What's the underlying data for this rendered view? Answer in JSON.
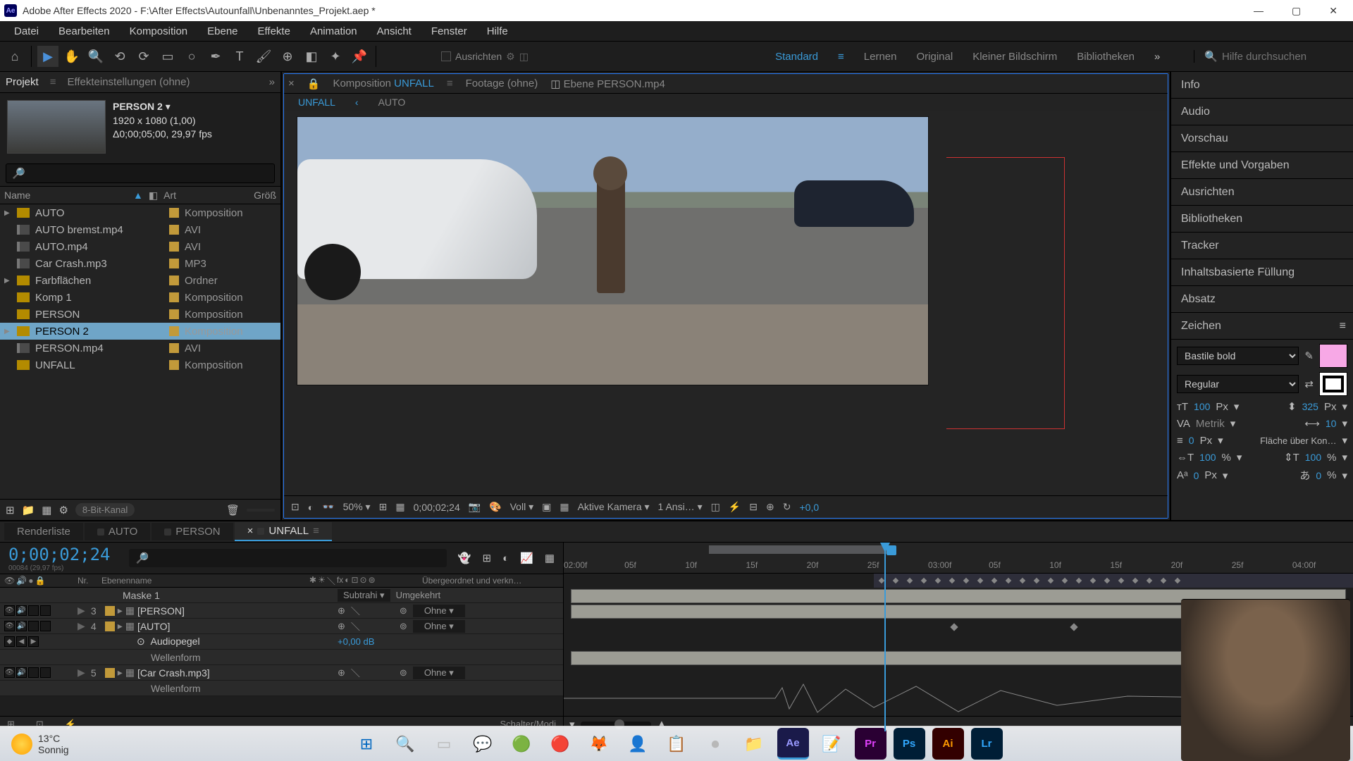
{
  "titlebar": {
    "app": "Adobe After Effects 2020",
    "path": "F:\\After Effects\\Autounfall\\Unbenanntes_Projekt.aep *"
  },
  "menu": [
    "Datei",
    "Bearbeiten",
    "Komposition",
    "Ebene",
    "Effekte",
    "Animation",
    "Ansicht",
    "Fenster",
    "Hilfe"
  ],
  "toolbar": {
    "ausrichten": "Ausrichten",
    "workspaces": [
      "Standard",
      "Lernen",
      "Original",
      "Kleiner Bildschirm",
      "Bibliotheken"
    ],
    "active_workspace": "Standard",
    "search_placeholder": "Hilfe durchsuchen"
  },
  "project": {
    "tab_project": "Projekt",
    "tab_effects": "Effekteinstellungen  (ohne)",
    "sel_name": "PERSON 2",
    "sel_dim": "1920 x 1080 (1,00)",
    "sel_dur": "Δ0;00;05;00, 29,97 fps",
    "cols": {
      "name": "Name",
      "type": "Art",
      "size": "Größ"
    },
    "items": [
      {
        "name": "AUTO",
        "type": "Komposition",
        "icon": "comp",
        "tw": "▶"
      },
      {
        "name": "AUTO bremst.mp4",
        "type": "AVI",
        "icon": "avi"
      },
      {
        "name": "AUTO.mp4",
        "type": "AVI",
        "icon": "avi"
      },
      {
        "name": "Car Crash.mp3",
        "type": "MP3",
        "icon": "mp3"
      },
      {
        "name": "Farbflächen",
        "type": "Ordner",
        "icon": "folder",
        "tw": "▶"
      },
      {
        "name": "Komp 1",
        "type": "Komposition",
        "icon": "comp"
      },
      {
        "name": "PERSON",
        "type": "Komposition",
        "icon": "comp"
      },
      {
        "name": "PERSON 2",
        "type": "Komposition",
        "icon": "comp",
        "sel": true,
        "tw": "▶"
      },
      {
        "name": "PERSON.mp4",
        "type": "AVI",
        "icon": "avi"
      },
      {
        "name": "UNFALL",
        "type": "Komposition",
        "icon": "comp"
      }
    ],
    "depth_label": "8-Bit-Kanal"
  },
  "viewer": {
    "tabs": {
      "comp_prefix": "Komposition",
      "comp_name": "UNFALL",
      "footage": "Footage  (ohne)",
      "layer": "Ebene  PERSON.mp4"
    },
    "breadcrumb": [
      "UNFALL",
      "AUTO"
    ],
    "footer": {
      "zoom": "50%",
      "tc": "0;00;02;24",
      "res": "Voll",
      "cam": "Aktive Kamera",
      "views": "1 Ansi…",
      "exp": "+0,0"
    }
  },
  "panels": {
    "names": [
      "Info",
      "Audio",
      "Vorschau",
      "Effekte und Vorgaben",
      "Ausrichten",
      "Bibliotheken",
      "Tracker",
      "Inhaltsbasierte Füllung",
      "Absatz"
    ],
    "zeichen": "Zeichen",
    "char": {
      "font": "Bastile bold",
      "style": "Regular",
      "size": "100",
      "px": "Px",
      "leading": "325",
      "kerning": "Metrik",
      "tracking": "10",
      "stroke": "0",
      "stroke_label": "Fläche über Kon…",
      "hscale": "100",
      "pct": "%",
      "vscale": "100",
      "baseline": "0",
      "tsume": "0"
    }
  },
  "timeline": {
    "tabs": [
      "Renderliste",
      "AUTO",
      "PERSON",
      "UNFALL"
    ],
    "active_tab": "UNFALL",
    "timecode": "0;00;02;24",
    "timecode_sub": "00084 (29,97 fps)",
    "header": {
      "nr": "Nr.",
      "layer": "Ebenenname",
      "parent": "Übergeordnet und verkn…"
    },
    "ruler": [
      "02:00f",
      "05f",
      "10f",
      "15f",
      "20f",
      "25f",
      "03:00f",
      "05f",
      "10f",
      "15f",
      "20f",
      "25f",
      "04:00f"
    ],
    "rows": [
      {
        "idx": "",
        "name": "Maske 1",
        "type": "mask",
        "mode": "Subtrahi",
        "inv": "Umgekehrt"
      },
      {
        "idx": "3",
        "name": "[PERSON]",
        "type": "precomp",
        "parent": "Ohne"
      },
      {
        "idx": "4",
        "name": "[AUTO]",
        "type": "precomp",
        "parent": "Ohne"
      },
      {
        "idx": "",
        "name": "Audiopegel",
        "type": "prop",
        "val": "+0,00 dB"
      },
      {
        "idx": "",
        "name": "Wellenform",
        "type": "subprop"
      },
      {
        "idx": "5",
        "name": "[Car Crash.mp3]",
        "type": "audio",
        "parent": "Ohne"
      },
      {
        "idx": "",
        "name": "Wellenform",
        "type": "subprop"
      }
    ],
    "schalter": "Schalter/Modi"
  },
  "taskbar": {
    "temp": "13°C",
    "cond": "Sonnig"
  }
}
